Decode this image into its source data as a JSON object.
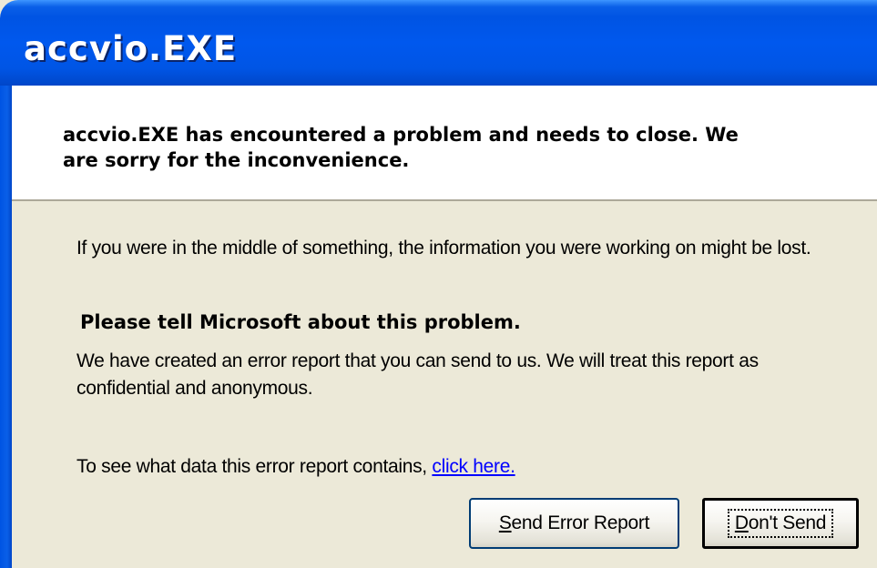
{
  "window": {
    "title": "accvio.EXE"
  },
  "header": {
    "message": "accvio.EXE has encountered a problem and needs to close.  We are sorry for the inconvenience."
  },
  "body": {
    "info": "If you were in the middle of something, the information you were working on might be lost.",
    "heading": "Please tell Microsoft about this problem.",
    "report_text": "We have created an error report that you can send to us.  We will treat this report as confidential and anonymous.",
    "details_prefix": "To see what data this error report contains,",
    "details_link": "click here."
  },
  "buttons": {
    "send_mnemonic": "S",
    "send_rest": "end Error Report",
    "dont_mnemonic": "D",
    "dont_rest": "on't Send"
  }
}
